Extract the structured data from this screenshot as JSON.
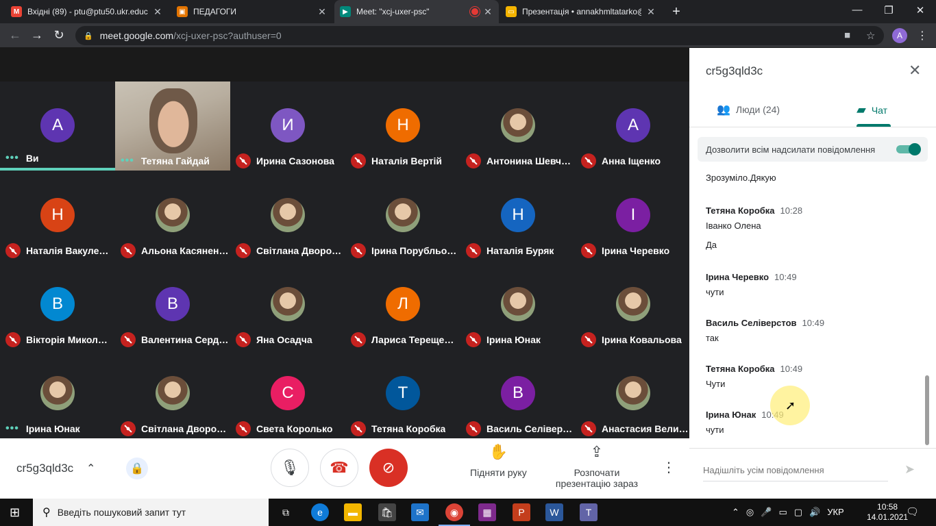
{
  "browser": {
    "tabs": [
      {
        "title": "Вхідні (89) - ptu@ptu50.ukr.educ",
        "icon": "gmail-icon",
        "color": "#ea4335"
      },
      {
        "title": "ПЕДАГОГИ",
        "icon": "classroom-icon",
        "color": "#e37400"
      },
      {
        "title": "Meet: \"xcj-uxer-psc\"",
        "icon": "meet-icon",
        "color": "#00897b",
        "recording": true
      },
      {
        "title": "Презентація • annakhmltatarko@",
        "icon": "slides-icon",
        "color": "#f4b400"
      }
    ],
    "url_host": "meet.google.com",
    "url_path": "/xcj-uxer-psc?authuser=0",
    "profile_initial": "A"
  },
  "grid": {
    "tiles": [
      {
        "name": "Ви",
        "initial": "A",
        "color": "#5e35b1",
        "muted": false,
        "speaking": true
      },
      {
        "name": "Тетяна Гайдай",
        "initial": "",
        "color": "",
        "muted": false,
        "video": true
      },
      {
        "name": "Ирина Сазонова",
        "initial": "И",
        "color": "#7e57c2",
        "muted": true
      },
      {
        "name": "Наталія Вертій",
        "initial": "Н",
        "color": "#ef6c00",
        "muted": true
      },
      {
        "name": "Антонина Шевч…",
        "initial": "",
        "color": "",
        "muted": true,
        "photo": true
      },
      {
        "name": "Анна Іщенко",
        "initial": "A",
        "color": "#5e35b1",
        "muted": true
      },
      {
        "name": "Наталія Вакуле…",
        "initial": "Н",
        "color": "#d84315",
        "muted": true
      },
      {
        "name": "Альона Касянен…",
        "initial": "",
        "color": "",
        "muted": true,
        "photo": true
      },
      {
        "name": "Світлана Дворо…",
        "initial": "",
        "color": "",
        "muted": true,
        "photo": true
      },
      {
        "name": "Ірина Порубльо…",
        "initial": "",
        "color": "",
        "muted": true,
        "photo": true
      },
      {
        "name": "Наталія Буряк",
        "initial": "Н",
        "color": "#1565c0",
        "muted": true
      },
      {
        "name": "Ірина Черевко",
        "initial": "І",
        "color": "#7b1fa2",
        "muted": true
      },
      {
        "name": "Вікторія Микол…",
        "initial": "В",
        "color": "#0288d1",
        "muted": true
      },
      {
        "name": "Валентина Серд…",
        "initial": "В",
        "color": "#5e35b1",
        "muted": true
      },
      {
        "name": "Яна Осадча",
        "initial": "",
        "color": "",
        "muted": true,
        "photo": true
      },
      {
        "name": "Лариса Терещe…",
        "initial": "Л",
        "color": "#ef6c00",
        "muted": true
      },
      {
        "name": "Ірина Юнак",
        "initial": "",
        "color": "",
        "muted": true,
        "photo": true
      },
      {
        "name": "Ірина Ковальова",
        "initial": "",
        "color": "",
        "muted": true,
        "photo": true
      },
      {
        "name": "Ірина Юнак",
        "initial": "",
        "color": "",
        "muted": false,
        "photo": true
      },
      {
        "name": "Світлана Дворо…",
        "initial": "",
        "color": "",
        "muted": true,
        "photo": true
      },
      {
        "name": "Света Королько",
        "initial": "C",
        "color": "#e91e63",
        "muted": true
      },
      {
        "name": "Тетяна Коробка",
        "initial": "T",
        "color": "#01579b",
        "muted": true
      },
      {
        "name": "Василь Селівер…",
        "initial": "В",
        "color": "#7b1fa2",
        "muted": true
      },
      {
        "name": "Анастасия Вели…",
        "initial": "",
        "color": "",
        "muted": true,
        "photo": true
      }
    ]
  },
  "bottombar": {
    "meeting_code": "cr5g3qld3c",
    "raise_hand": "Підняти руку",
    "present": "Розпочати презентацію зараз"
  },
  "panel": {
    "title": "cr5g3qld3c",
    "people_tab": "Люди (24)",
    "chat_tab": "Чат",
    "allow_label": "Дозволити всім надсилати повідомлення",
    "messages": [
      {
        "sender": "",
        "time": "",
        "text": "Зрозуміло.Дякую"
      },
      {
        "sender": "Тетяна Коробка",
        "time": "10:28",
        "text": "Іванко Олена"
      },
      {
        "sender": "",
        "time": "",
        "text": "Да"
      },
      {
        "sender": "Ірина Черевко",
        "time": "10:49",
        "text": "чути"
      },
      {
        "sender": "Василь Селіверстов",
        "time": "10:49",
        "text": "так"
      },
      {
        "sender": "Тетяна Коробка",
        "time": "10:49",
        "text": "Чути"
      },
      {
        "sender": "Ірина Юнак",
        "time": "10:49",
        "text": "чути"
      }
    ],
    "compose_placeholder": "Надішліть усім повідомлення"
  },
  "taskbar": {
    "search_placeholder": "Введіть пошуковий запит тут",
    "lang": "УКР",
    "time": "10:58",
    "date": "14.01.2021"
  }
}
